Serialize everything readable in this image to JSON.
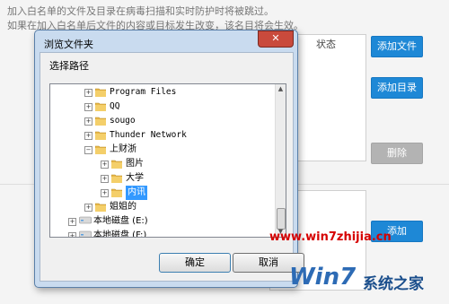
{
  "background": {
    "line1": "加入白名单的文件及目录在病毒扫描和实时防护时将被跳过。",
    "line2": "如果在加入白名单后文件的内容或目标发生改变，该名目将会生效。",
    "status_col": "状态",
    "add_file": "添加文件",
    "add_dir": "添加目录",
    "delete": "删除",
    "add": "添加"
  },
  "dialog": {
    "title": "浏览文件夹",
    "close": "✕",
    "path_label": "选择路径",
    "tree": [
      {
        "label": "Program Files",
        "level": 1,
        "expander": "+",
        "mono": true
      },
      {
        "label": "QQ",
        "level": 1,
        "expander": "+",
        "mono": true
      },
      {
        "label": "sougo",
        "level": 1,
        "expander": "+",
        "mono": true
      },
      {
        "label": "Thunder Network",
        "level": 1,
        "expander": "+",
        "mono": true
      },
      {
        "label": "上财浙",
        "level": 1,
        "expander": "−",
        "mono": false
      },
      {
        "label": "图片",
        "level": 2,
        "expander": "+",
        "mono": false
      },
      {
        "label": "大学",
        "level": 2,
        "expander": "+",
        "mono": false
      },
      {
        "label": "内讯",
        "level": 2,
        "expander": "+",
        "mono": false,
        "selected": true
      },
      {
        "label": "姐姐的",
        "level": 1,
        "expander": "+",
        "mono": false
      },
      {
        "label": "本地磁盘 (E:)",
        "level": 0,
        "expander": "+",
        "mono": false,
        "drive": true
      },
      {
        "label": "本地磁盘 (F:)",
        "level": 0,
        "expander": "+",
        "mono": false,
        "drive": true
      }
    ],
    "ok": "确定",
    "cancel": "取消"
  },
  "watermark": {
    "url": "www.win7zhijia.cn",
    "brand": "系统之家",
    "win": "Win7"
  },
  "colors": {
    "accent": "#1e88d6",
    "selection": "#3399ff",
    "watermark_red": "#d60000"
  }
}
